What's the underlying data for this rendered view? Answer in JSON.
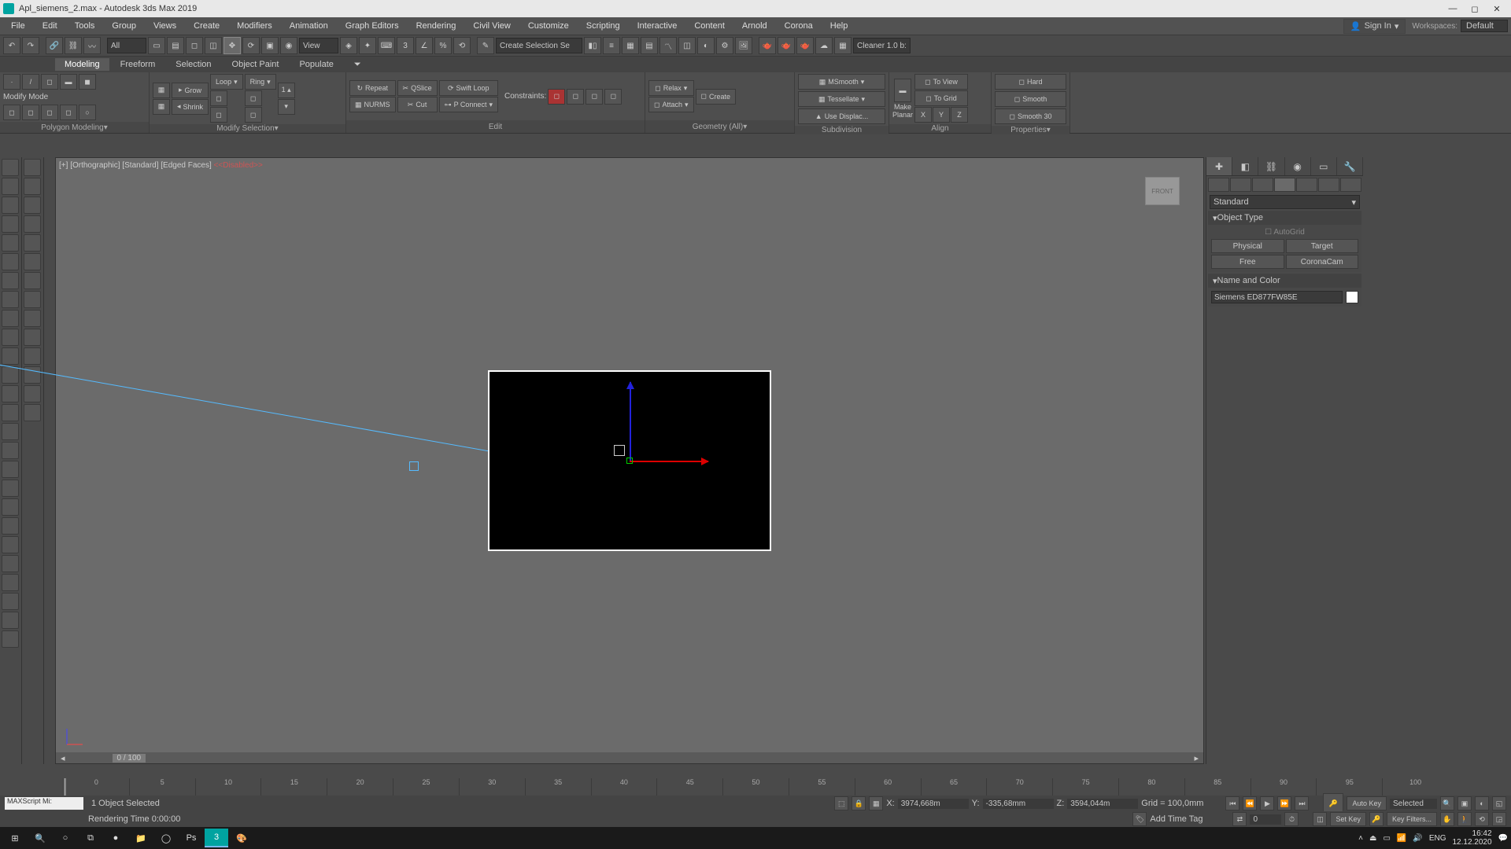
{
  "title": "Apl_siemens_2.max - Autodesk 3ds Max 2019",
  "menus": [
    "File",
    "Edit",
    "Tools",
    "Group",
    "Views",
    "Create",
    "Modifiers",
    "Animation",
    "Graph Editors",
    "Rendering",
    "Civil View",
    "Customize",
    "Scripting",
    "Interactive",
    "Content",
    "Arnold",
    "Corona",
    "Help"
  ],
  "signin": "Sign In",
  "workspaces_label": "Workspaces:",
  "workspaces_value": "Default",
  "toolbar": {
    "all": "All",
    "view": "View",
    "create_sel": "Create Selection Se",
    "cleaner": "Cleaner 1.0 b:"
  },
  "ribbon_tabs": [
    "Modeling",
    "Freeform",
    "Selection",
    "Object Paint",
    "Populate"
  ],
  "ribbon": {
    "poly": {
      "title": "Polygon Modeling",
      "modify_mode": "Modify Mode"
    },
    "modsel": {
      "title": "Modify Selection",
      "grow": "Grow",
      "shrink": "Shrink",
      "loop": "Loop",
      "ring": "Ring"
    },
    "edit": {
      "title": "Edit",
      "repeat": "Repeat",
      "nurms": "NURMS",
      "qslice": "QSlice",
      "cut": "Cut",
      "swiftloop": "Swift Loop",
      "pconnect": "P Connect",
      "constraints": "Constraints:"
    },
    "geom": {
      "title": "Geometry (All)",
      "relax": "Relax",
      "attach": "Attach",
      "create": "Create"
    },
    "subdiv": {
      "title": "Subdivision",
      "msmooth": "MSmooth",
      "tessellate": "Tessellate",
      "usedisp": "Use Displac..."
    },
    "align": {
      "title": "Align",
      "make": "Make",
      "planar": "Planar",
      "x": "X",
      "y": "Y",
      "z": "Z",
      "toview": "To View",
      "togrid": "To Grid"
    },
    "props": {
      "title": "Properties",
      "hard": "Hard",
      "smooth": "Smooth",
      "smooth30": "Smooth 30"
    }
  },
  "viewport": {
    "label_plus": "[+]",
    "label_view": "[Orthographic]",
    "label_shade": "[Standard]",
    "label_edge": "[Edged Faces]",
    "label_dis": "<<Disabled>>",
    "cube": "FRONT",
    "slider": "0 / 100"
  },
  "cmd": {
    "dropdown": "Standard",
    "objtype": "Object Type",
    "autogrid": "AutoGrid",
    "btns": [
      "Physical",
      "Target",
      "Free",
      "CoronaCam"
    ],
    "nameandcolor": "Name and Color",
    "objname": "Siemens ED877FW85E"
  },
  "timeline_ticks": [
    "0",
    "5",
    "10",
    "15",
    "20",
    "25",
    "30",
    "35",
    "40",
    "45",
    "50",
    "55",
    "60",
    "65",
    "70",
    "75",
    "80",
    "85",
    "90",
    "95",
    "100"
  ],
  "status": {
    "maxscript": "MAXScript Mi:",
    "selected": "1 Object Selected",
    "rendering": "Rendering Time  0:00:00",
    "x_lbl": "X:",
    "x": "3974,668m",
    "y_lbl": "Y:",
    "y": "-335,68mm",
    "z_lbl": "Z:",
    "z": "3594,044m",
    "grid": "Grid = 100,0mm",
    "addtime": "Add Time Tag",
    "autokey": "Auto Key",
    "setkey": "Set Key",
    "selected_mode": "Selected",
    "keyfilters": "Key Filters...",
    "frame": "0"
  },
  "taskbar": {
    "lang": "ENG",
    "time": "16:42",
    "date": "12.12.2020"
  }
}
